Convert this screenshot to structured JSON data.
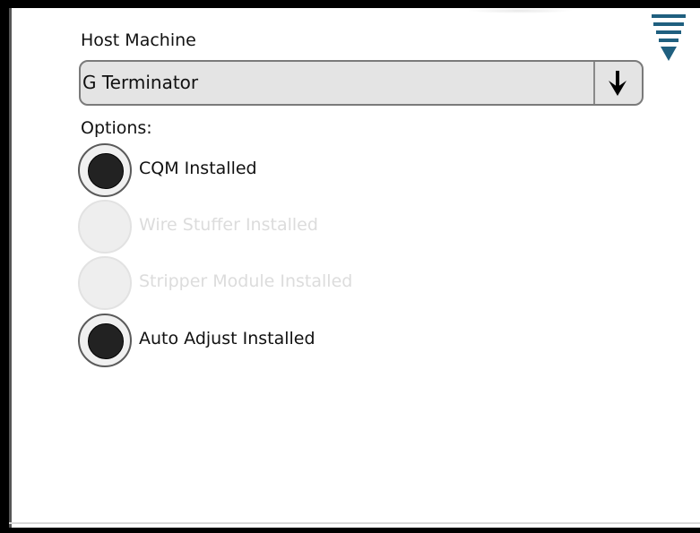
{
  "host_machine": {
    "label": "Host Machine",
    "selected": "G Terminator",
    "arrow_icon": "down-arrow-icon"
  },
  "options": {
    "label": "Options:",
    "items": [
      {
        "label": "CQM Installed",
        "checked": true,
        "enabled": true
      },
      {
        "label": "Wire Stuffer Installed",
        "checked": false,
        "enabled": false
      },
      {
        "label": "Stripper Module Installed",
        "checked": false,
        "enabled": false
      },
      {
        "label": "Auto Adjust Installed",
        "checked": true,
        "enabled": true
      }
    ]
  },
  "menu": {
    "icon": "menu-icon",
    "color": "#1f5f7f"
  }
}
